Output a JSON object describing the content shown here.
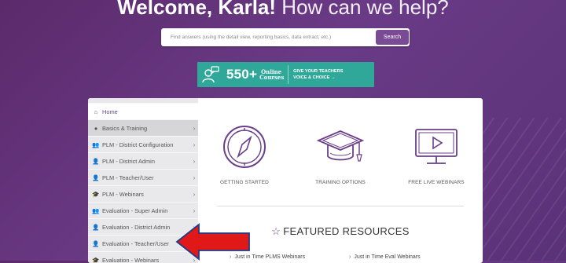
{
  "header": {
    "welcome_bold": "Welcome, Karla!",
    "welcome_rest": "How can we help?"
  },
  "search": {
    "placeholder": "Find answers (using the detail view, reporting basics, data extract, etc.)",
    "button_label": "Search"
  },
  "banner": {
    "count": "550+",
    "label_line1": "Online",
    "label_line2": "Courses",
    "cta_line1": "GIVE YOUR TEACHERS",
    "cta_line2": "VOICE & CHOICE →"
  },
  "sidebar": {
    "items": [
      {
        "label": "Home",
        "icon": "home-icon",
        "chevron": ""
      },
      {
        "label": "Basics & Training",
        "icon": "circle-icon",
        "chevron": "›"
      },
      {
        "label": "PLM - District Configuration",
        "icon": "users-icon",
        "chevron": "›"
      },
      {
        "label": "PLM - District Admin",
        "icon": "user-icon",
        "chevron": "›"
      },
      {
        "label": "PLM - Teacher/User",
        "icon": "user-icon",
        "chevron": "›"
      },
      {
        "label": "PLM - Webinars",
        "icon": "graduation-cap-icon",
        "chevron": "›"
      },
      {
        "label": "Evaluation - Super Admin",
        "icon": "users-icon",
        "chevron": "›"
      },
      {
        "label": "Evaluation - District Admin",
        "icon": "user-icon",
        "chevron": "›"
      },
      {
        "label": "Evaluation - Teacher/User",
        "icon": "user-icon",
        "chevron": "›"
      },
      {
        "label": "Evaluation - Webinars",
        "icon": "graduation-cap-icon",
        "chevron": "›"
      }
    ]
  },
  "features": [
    {
      "label": "GETTING STARTED",
      "icon": "compass-icon"
    },
    {
      "label": "TRAINING OPTIONS",
      "icon": "graduation-cap-icon"
    },
    {
      "label": "FREE LIVE WEBINARS",
      "icon": "monitor-play-icon"
    }
  ],
  "featured": {
    "title": "FEATURED RESOURCES",
    "links": [
      {
        "label": "Just in Time PLMS Webinars"
      },
      {
        "label": "Just in Time Eval Webinars"
      }
    ]
  },
  "colors": {
    "brand_purple": "#6a3f8a",
    "banner_teal": "#2fa89a",
    "annotation_red": "#e01818"
  }
}
